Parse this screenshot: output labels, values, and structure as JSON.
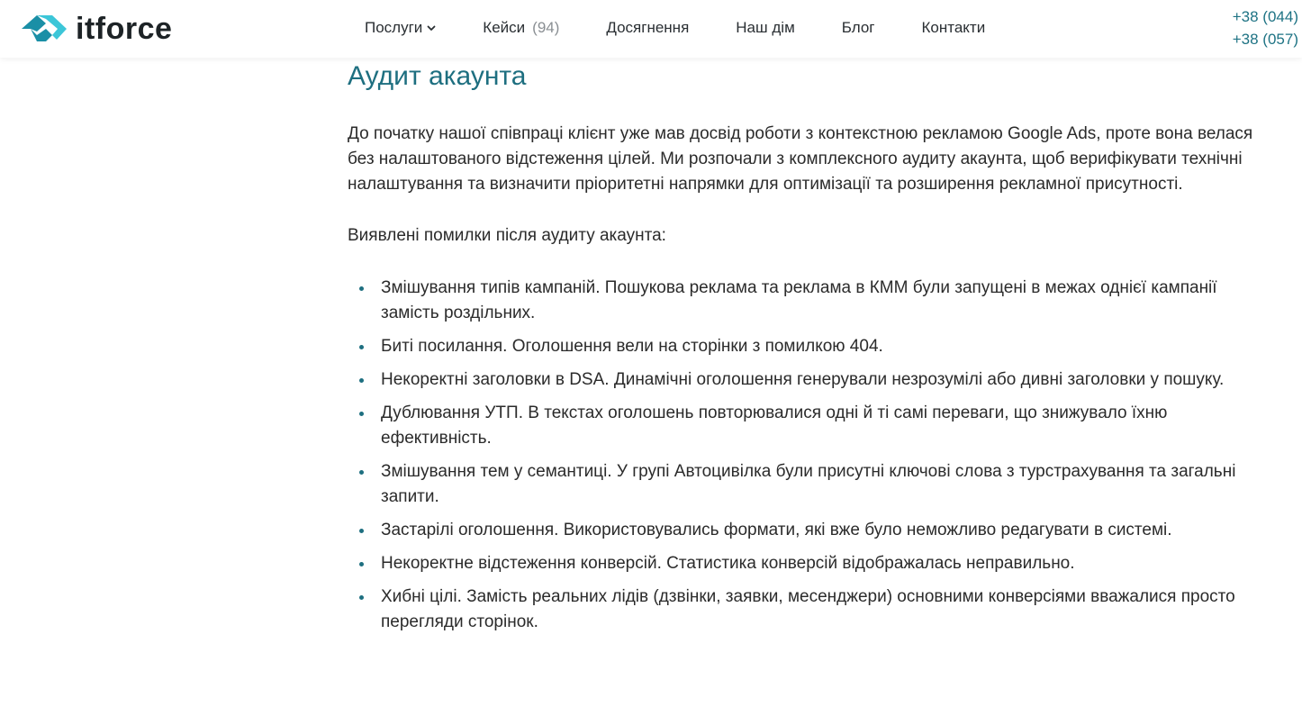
{
  "brand": {
    "name": "itforce",
    "colors": {
      "primary": "#1e6f80",
      "accent_light": "#3cc6d8",
      "accent_dark": "#1a8fa6"
    }
  },
  "nav": {
    "items": [
      {
        "label": "Послуги",
        "icon": "chevron-down-icon"
      },
      {
        "label": "Кейси",
        "count": "(94)"
      },
      {
        "label": "Досягнення"
      },
      {
        "label": "Наш дім"
      },
      {
        "label": "Блог"
      },
      {
        "label": "Контакти"
      }
    ]
  },
  "contacts": {
    "phones": [
      "+38 (044)",
      "+38 (057)"
    ]
  },
  "article": {
    "section_title": "Аудит акаунта",
    "intro": "До початку нашої співпраці клієнт уже мав досвід роботи з контекстною рекламою Google Ads, проте вона велася без налаштованого відстеження цілей. Ми розпочали з комплексного аудиту акаунта, щоб верифікувати технічні налаштування та визначити пріоритетні напрямки для оптимізації та розширення рекламної присутності.",
    "issues_lead": "Виявлені помилки після аудиту акаунта:",
    "issues": [
      "Змішування типів кампаній. Пошукова реклама та реклама в КММ були запущені в межах однієї кампанії замість роздільних.",
      "Биті посилання. Оголошення вели на сторінки з помилкою 404.",
      "Некоректні заголовки в DSA. Динамічні оголошення генерували незрозумілі або дивні заголовки у пошуку.",
      "Дублювання УТП. В текстах оголошень повторювалися одні й ті самі переваги, що знижувало їхню ефективність.",
      "Змішування тем у семантиці. У групі Автоцивілка були присутні ключові слова з турстрахування та загальні запити.",
      "Застарілі оголошення. Використовувались формати, які вже було неможливо редагувати в системі.",
      "Некоректне відстеження конверсій. Статистика конверсій відображалась неправильно.",
      "Хибні цілі. Замість реальних лідів (дзвінки, заявки, месенджери) основними конверсіями вважалися просто перегляди сторінок."
    ]
  }
}
